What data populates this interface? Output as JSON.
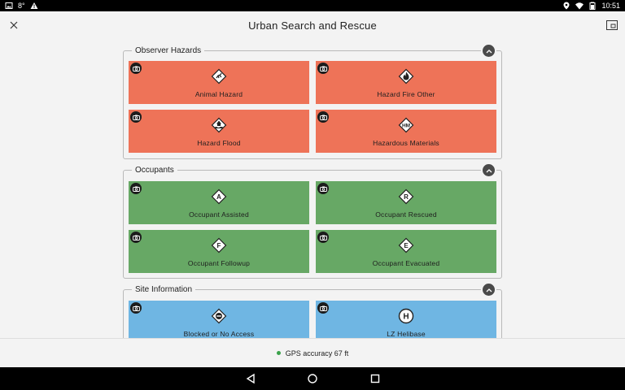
{
  "status_bar": {
    "notification_count": "8",
    "temperature_unit": "°",
    "time": "10:51"
  },
  "header": {
    "title": "Urban Search and Rescue"
  },
  "groups": [
    {
      "title": "Observer Hazards",
      "color": "#ee7358",
      "tiles": [
        {
          "label": "Animal Hazard",
          "icon": "animal-icon"
        },
        {
          "label": "Hazard Fire Other",
          "icon": "fire-icon"
        },
        {
          "label": "Hazard Flood",
          "icon": "flood-icon"
        },
        {
          "label": "Hazardous Materials",
          "icon": "hm-icon",
          "icon_text": "HM"
        }
      ]
    },
    {
      "title": "Occupants",
      "color": "#67a865",
      "tiles": [
        {
          "label": "Occupant Assisted",
          "icon": "letter-a-icon",
          "icon_text": "A"
        },
        {
          "label": "Occupant Rescued",
          "icon": "letter-r-icon",
          "icon_text": "R"
        },
        {
          "label": "Occupant Followup",
          "icon": "letter-f-icon",
          "icon_text": "F"
        },
        {
          "label": "Occupant Evacuated",
          "icon": "letter-e-icon",
          "icon_text": "E"
        }
      ]
    },
    {
      "title": "Site Information",
      "color": "#6fb6e3",
      "tiles": [
        {
          "label": "Blocked or No Access",
          "icon": "no-entry-icon"
        },
        {
          "label": "LZ Helibase",
          "icon": "helibase-icon",
          "icon_text": "H"
        }
      ]
    }
  ],
  "footer": {
    "gps_text": "GPS accuracy 67 ft",
    "gps_status_color": "#3aa14a"
  }
}
